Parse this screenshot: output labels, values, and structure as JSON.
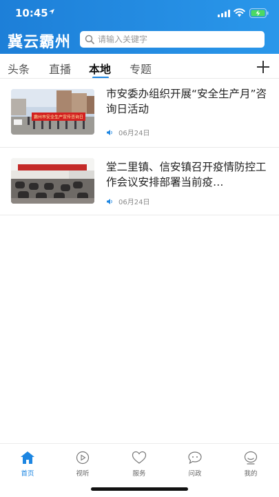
{
  "status_bar": {
    "time": "10:45"
  },
  "header": {
    "app_title": "冀云霸州",
    "search": {
      "placeholder": "请输入关键字",
      "value": ""
    }
  },
  "tabs": [
    {
      "label": "头条",
      "active": false
    },
    {
      "label": "直播",
      "active": false
    },
    {
      "label": "本地",
      "active": true
    },
    {
      "label": "专题",
      "active": false
    }
  ],
  "news": [
    {
      "title": "市安委办组织开展“安全生产月”咨询日活动",
      "date": "06月24日",
      "banner_text": "霸州市安全生产宣传咨询日"
    },
    {
      "title": "堂二里镇、信安镇召开疫情防控工作会议安排部署当前疫…",
      "date": "06月24日"
    }
  ],
  "tabbar": [
    {
      "label": "首页",
      "icon": "home-icon",
      "active": true
    },
    {
      "label": "视听",
      "icon": "play-icon",
      "active": false
    },
    {
      "label": "服务",
      "icon": "heart-icon",
      "active": false
    },
    {
      "label": "问政",
      "icon": "chat-icon",
      "active": false
    },
    {
      "label": "我的",
      "icon": "user-icon",
      "active": false
    }
  ],
  "colors": {
    "brand": "#1d86e2",
    "header_start": "#1d7fd8",
    "header_end": "#2a97ea"
  }
}
